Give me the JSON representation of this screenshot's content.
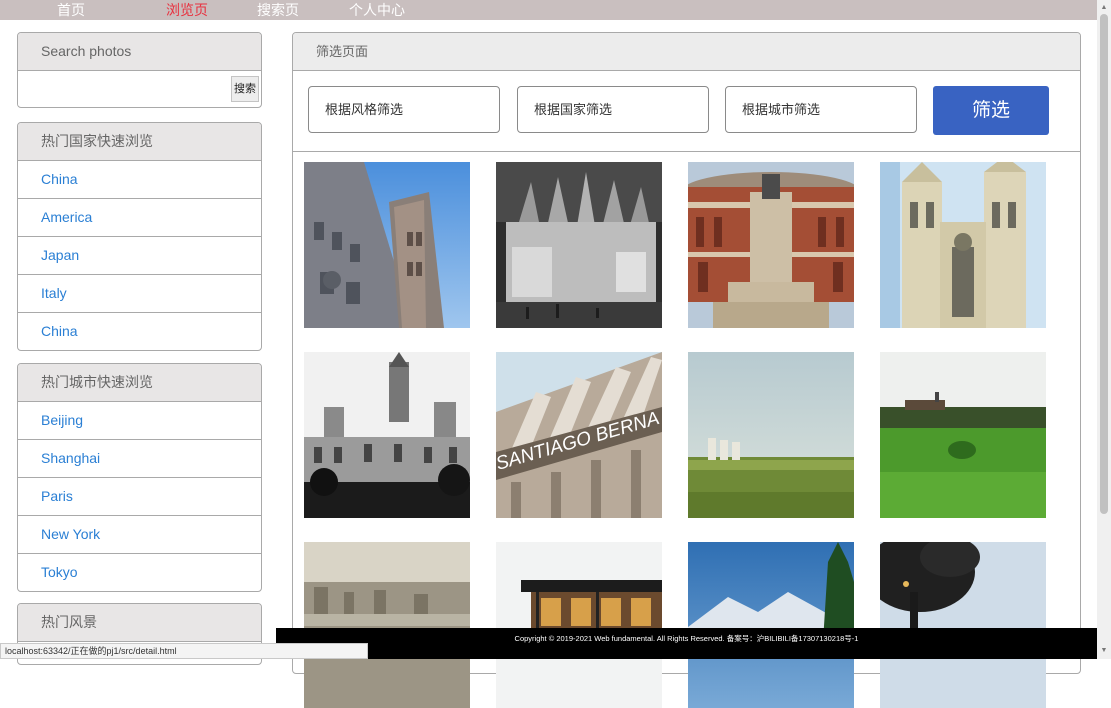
{
  "nav": {
    "items": [
      {
        "label": "首页",
        "active": false
      },
      {
        "label": "浏览页",
        "active": true
      },
      {
        "label": "搜索页",
        "active": false
      },
      {
        "label": "个人中心",
        "active": false
      }
    ]
  },
  "search": {
    "title": "Search photos",
    "value": "",
    "button_label": "搜索"
  },
  "hot_countries": {
    "title": "热门国家快速浏览",
    "items": [
      "China",
      "America",
      "Japan",
      "Italy",
      "China"
    ]
  },
  "hot_cities": {
    "title": "热门城市快速浏览",
    "items": [
      "Beijing",
      "Shanghai",
      "Paris",
      "New York",
      "Tokyo"
    ]
  },
  "hot_scenery": {
    "title": "热门风景"
  },
  "main": {
    "title": "筛选页面",
    "filters": {
      "style_placeholder": "根据风格筛选",
      "country_placeholder": "根据国家筛选",
      "city_placeholder": "根据城市筛选",
      "button_label": "筛选"
    },
    "photo_text": {
      "stadium_sign": "SANTIAGO BERNA"
    }
  },
  "footer": {
    "text": "Copyright © 2019-2021 Web fundamental. All Rights Reserved. 备案号：沪BILIBILI备17307130218号-1"
  },
  "status_bar": {
    "url": "localhost:63342/正在做的pj1/src/detail.html"
  },
  "colors": {
    "nav_bg": "#c9bfbf",
    "nav_active": "#e8313f",
    "link": "#2a7fd4",
    "filter_button": "#3963c2",
    "footer_bg": "#000000"
  }
}
